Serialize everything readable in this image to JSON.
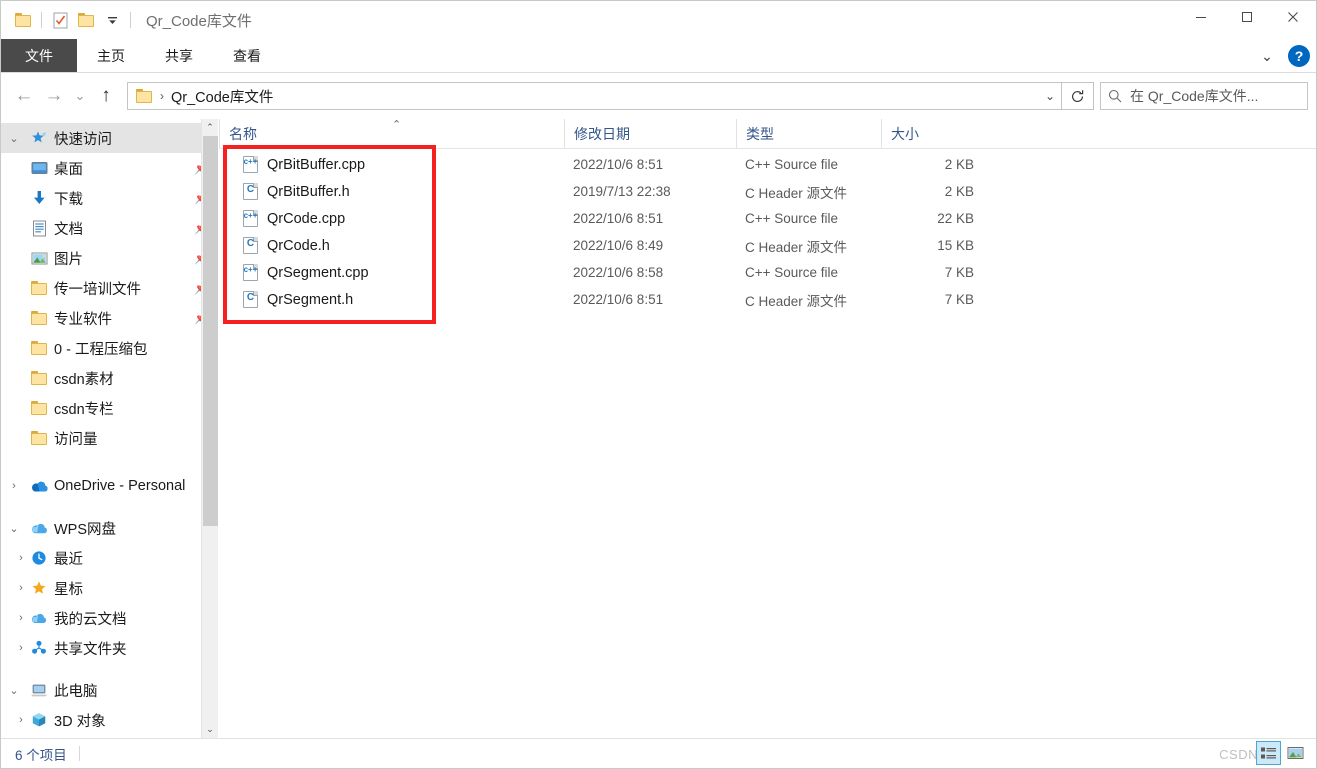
{
  "window": {
    "title": "Qr_Code库文件",
    "quick_access_toolbar": [
      {
        "name": "folder-icon",
        "label": "属性"
      },
      {
        "name": "properties-icon",
        "label": "属性"
      },
      {
        "name": "new-folder-icon",
        "label": "新建文件夹"
      },
      {
        "name": "customize-dropdown-icon",
        "label": "自定义快速访问工具栏"
      }
    ],
    "controls": {
      "minimize": "—",
      "maximize": "□",
      "close": "✕",
      "ribbon_chevron": "⌄",
      "help": "?"
    }
  },
  "ribbon": {
    "tabs": [
      {
        "label": "文件",
        "selected": true
      },
      {
        "label": "主页",
        "selected": false
      },
      {
        "label": "共享",
        "selected": false
      },
      {
        "label": "查看",
        "selected": false
      }
    ]
  },
  "navbar": {
    "back": "←",
    "forward": "→",
    "recent": "⌄",
    "up": "↑",
    "breadcrumb_sep": "›",
    "breadcrumb_text": "Qr_Code库文件",
    "address_dropdown": "⌄",
    "refresh": "↻"
  },
  "search": {
    "icon": "search-icon",
    "placeholder": "在 Qr_Code库文件..."
  },
  "sidebar": {
    "groups": [
      {
        "header": {
          "label": "快速访问",
          "twist": "⌄",
          "icon": "star-pin-icon",
          "selected": true
        },
        "items": [
          {
            "label": "桌面",
            "icon": "desktop-icon",
            "pinned": true,
            "twist": ""
          },
          {
            "label": "下载",
            "icon": "download-icon",
            "pinned": true,
            "twist": ""
          },
          {
            "label": "文档",
            "icon": "document-icon",
            "pinned": true,
            "twist": ""
          },
          {
            "label": "图片",
            "icon": "pictures-icon",
            "pinned": true,
            "twist": ""
          },
          {
            "label": "传一培训文件",
            "icon": "folder-icon",
            "pinned": true,
            "twist": ""
          },
          {
            "label": "专业软件",
            "icon": "folder-icon",
            "pinned": true,
            "twist": ""
          },
          {
            "label": "0 - 工程压缩包",
            "icon": "folder-icon",
            "pinned": false,
            "twist": ""
          },
          {
            "label": "csdn素材",
            "icon": "folder-icon",
            "pinned": false,
            "twist": ""
          },
          {
            "label": "csdn专栏",
            "icon": "folder-icon",
            "pinned": false,
            "twist": ""
          },
          {
            "label": "访问量",
            "icon": "folder-icon",
            "pinned": false,
            "twist": ""
          }
        ]
      },
      {
        "header": {
          "label": "OneDrive - Personal",
          "twist": "›",
          "icon": "onedrive-icon",
          "selected": false
        },
        "items": []
      },
      {
        "header": {
          "label": "WPS网盘",
          "twist": "⌄",
          "icon": "wps-cloud-icon",
          "selected": false
        },
        "items": [
          {
            "label": "最近",
            "icon": "clock-icon",
            "pinned": false,
            "twist": "›"
          },
          {
            "label": "星标",
            "icon": "star-icon",
            "pinned": false,
            "twist": "›"
          },
          {
            "label": "我的云文档",
            "icon": "cloud-icon",
            "pinned": false,
            "twist": "›"
          },
          {
            "label": "共享文件夹",
            "icon": "shared-icon",
            "pinned": false,
            "twist": "›"
          }
        ]
      },
      {
        "header": {
          "label": "此电脑",
          "twist": "⌄",
          "icon": "this-pc-icon",
          "selected": false
        },
        "items": [
          {
            "label": "3D 对象",
            "icon": "3d-objects-icon",
            "pinned": false,
            "twist": "›"
          }
        ]
      }
    ],
    "scroll_up": "⌃",
    "scroll_down": "⌄"
  },
  "filelist": {
    "columns": [
      {
        "key": "name",
        "label": "名称",
        "sorted": "asc",
        "sort_caret": "⌃"
      },
      {
        "key": "date",
        "label": "修改日期"
      },
      {
        "key": "type",
        "label": "类型"
      },
      {
        "key": "size",
        "label": "大小"
      }
    ],
    "rows": [
      {
        "name": "QrBitBuffer.cpp",
        "icon": "cpp-file-icon",
        "icon_letter": "c++",
        "date": "2022/10/6 8:51",
        "type": "C++ Source file",
        "size": "2 KB"
      },
      {
        "name": "QrBitBuffer.h",
        "icon": "h-file-icon",
        "icon_letter": "C",
        "date": "2019/7/13 22:38",
        "type": "C Header 源文件",
        "size": "2 KB"
      },
      {
        "name": "QrCode.cpp",
        "icon": "cpp-file-icon",
        "icon_letter": "c++",
        "date": "2022/10/6 8:51",
        "type": "C++ Source file",
        "size": "22 KB"
      },
      {
        "name": "QrCode.h",
        "icon": "h-file-icon",
        "icon_letter": "C",
        "date": "2022/10/6 8:49",
        "type": "C Header 源文件",
        "size": "15 KB"
      },
      {
        "name": "QrSegment.cpp",
        "icon": "cpp-file-icon",
        "icon_letter": "c++",
        "date": "2022/10/6 8:58",
        "type": "C++ Source file",
        "size": "7 KB"
      },
      {
        "name": "QrSegment.h",
        "icon": "h-file-icon",
        "icon_letter": "C",
        "date": "2022/10/6 8:51",
        "type": "C Header 源文件",
        "size": "7 KB"
      }
    ],
    "annotation_color": "#f52020"
  },
  "statusbar": {
    "item_count": "6 个项目",
    "watermark": "CSDN",
    "view_buttons": [
      {
        "name": "details-view-button",
        "selected": true
      },
      {
        "name": "large-icons-view-button",
        "selected": false
      }
    ]
  }
}
